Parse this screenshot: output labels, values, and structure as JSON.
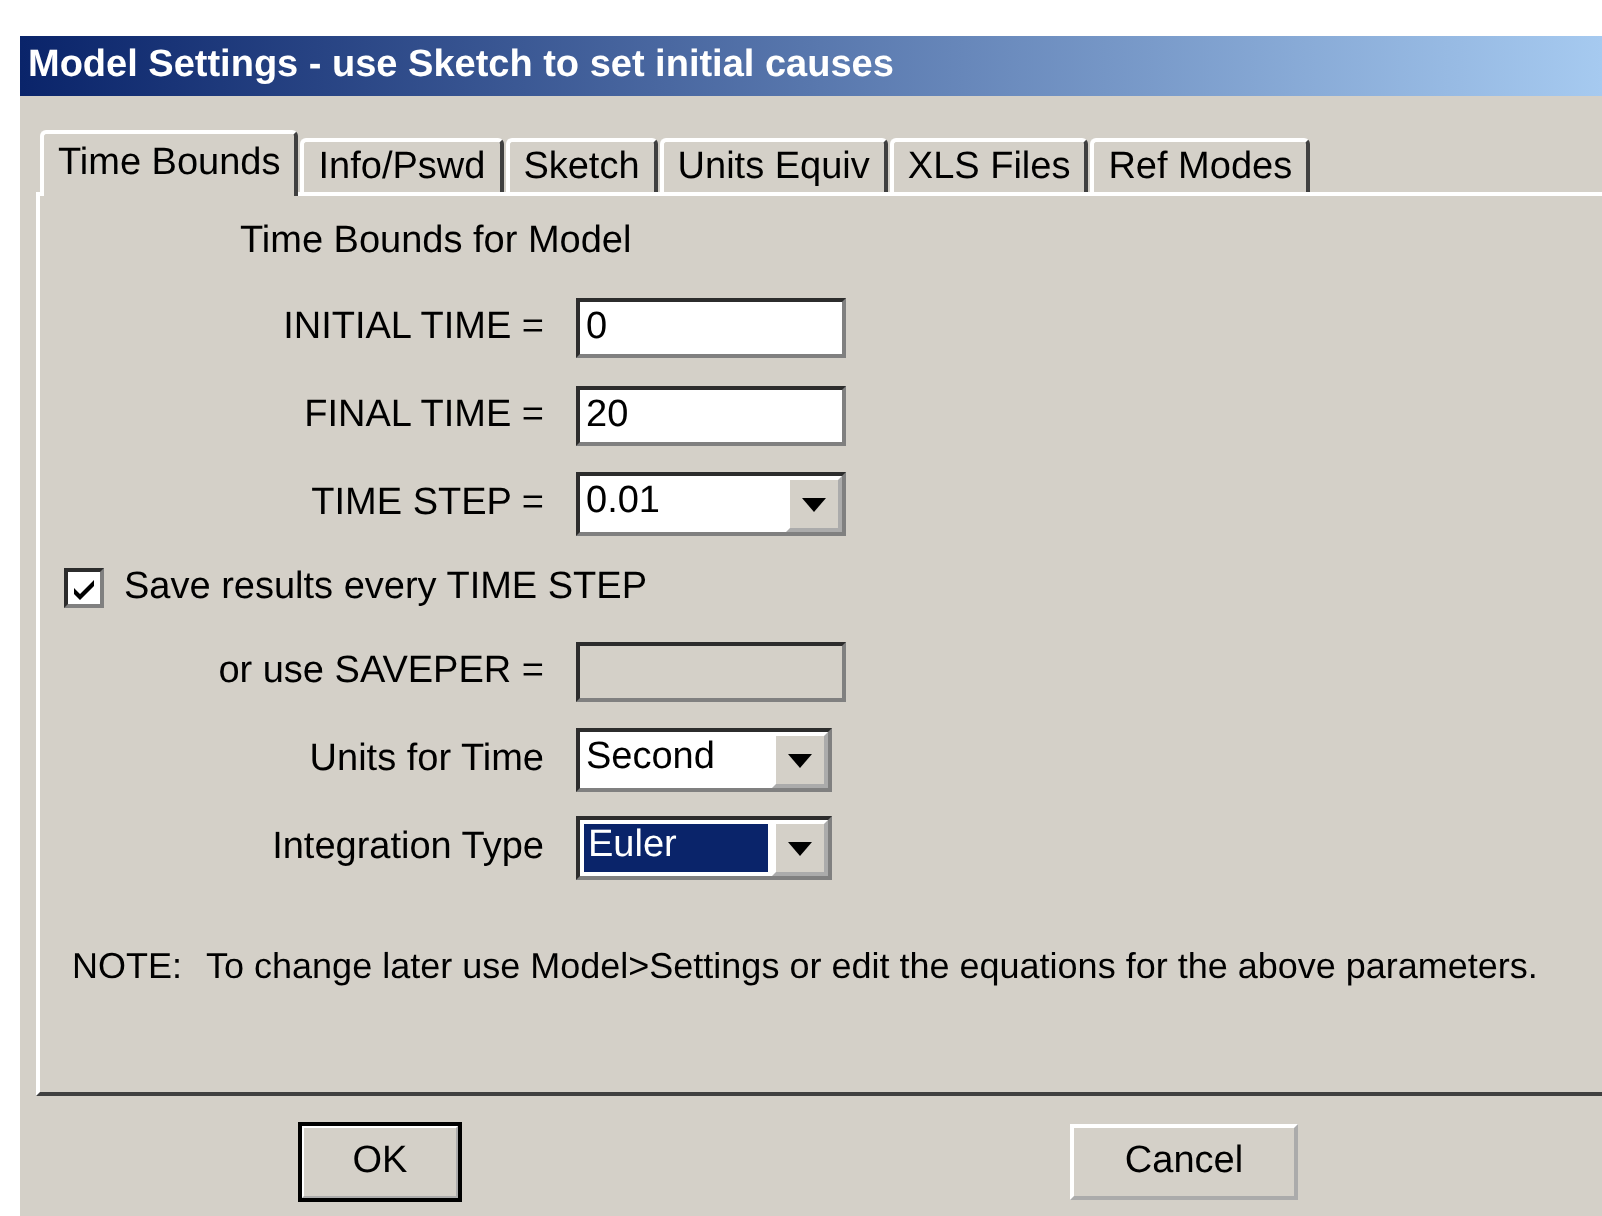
{
  "window": {
    "title": "Model Settings - use Sketch to set initial causes"
  },
  "tabs": [
    {
      "label": "Time Bounds",
      "selected": true
    },
    {
      "label": "Info/Pswd",
      "selected": false
    },
    {
      "label": "Sketch",
      "selected": false
    },
    {
      "label": "Units Equiv",
      "selected": false
    },
    {
      "label": "XLS Files",
      "selected": false
    },
    {
      "label": "Ref Modes",
      "selected": false
    }
  ],
  "heading": "Time Bounds for Model",
  "fields": [
    {
      "kind": "text",
      "label": "INITIAL TIME =",
      "value": "0",
      "disabled": false
    },
    {
      "kind": "text",
      "label": "FINAL TIME =",
      "value": "20",
      "disabled": false
    },
    {
      "kind": "dropdown",
      "label": "TIME STEP =",
      "value": "0.01",
      "focused": false
    },
    {
      "kind": "checkbox",
      "label": "Save results every TIME STEP",
      "checked": true
    },
    {
      "kind": "text",
      "label": "or use SAVEPER =",
      "disabled": true
    },
    {
      "kind": "dropdown",
      "label": "Units for Time",
      "value": "Second",
      "focused": false
    },
    {
      "kind": "dropdown",
      "label": "Integration Type",
      "value": "Euler",
      "focused": true
    }
  ],
  "note_label": "NOTE:",
  "note": "To change later use Model>Settings or edit the equations for the above parameters.",
  "buttons": [
    {
      "label": "OK",
      "default": true
    },
    {
      "label": "Cancel",
      "default": false
    }
  ]
}
